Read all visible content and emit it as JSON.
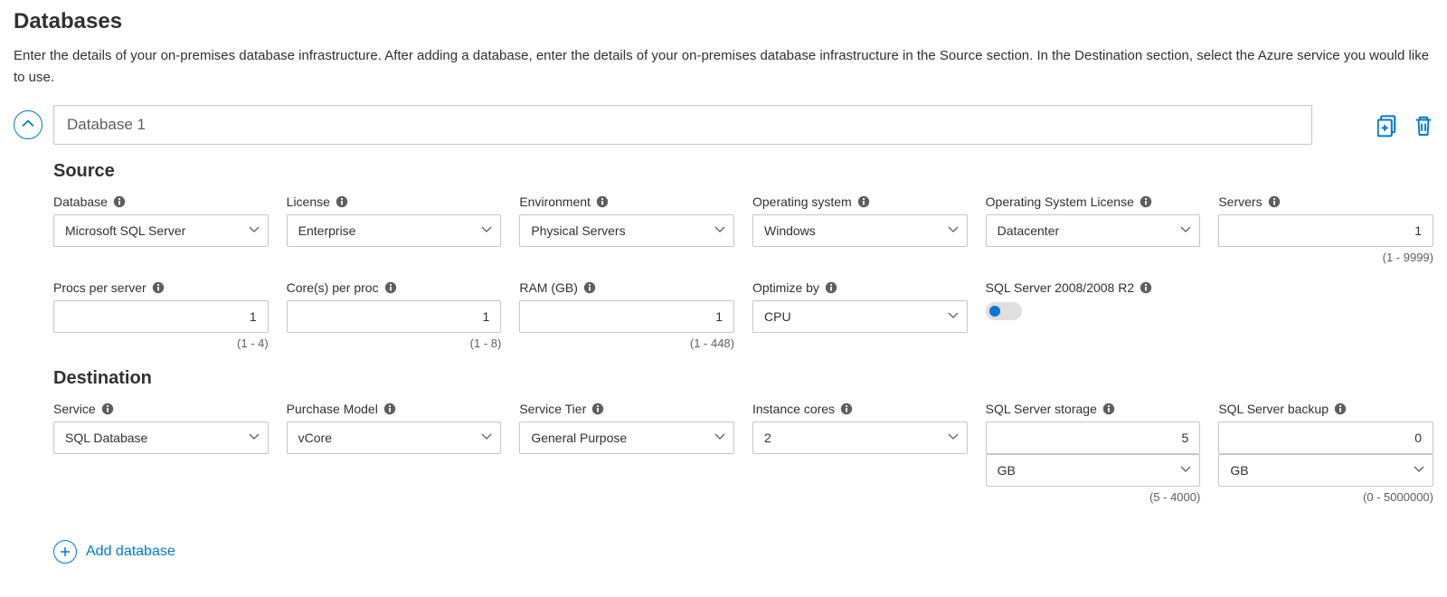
{
  "page": {
    "title": "Databases",
    "description": "Enter the details of your on-premises database infrastructure. After adding a database, enter the details of your on-premises database infrastructure in the Source section. In the Destination section, select the Azure service you would like to use."
  },
  "item": {
    "name": "Database 1"
  },
  "source": {
    "title": "Source",
    "database": {
      "label": "Database",
      "value": "Microsoft SQL Server"
    },
    "license": {
      "label": "License",
      "value": "Enterprise"
    },
    "environment": {
      "label": "Environment",
      "value": "Physical Servers"
    },
    "os": {
      "label": "Operating system",
      "value": "Windows"
    },
    "os_license": {
      "label": "Operating System License",
      "value": "Datacenter"
    },
    "servers": {
      "label": "Servers",
      "value": "1",
      "hint": "(1 - 9999)"
    },
    "procs": {
      "label": "Procs per server",
      "value": "1",
      "hint": "(1 - 4)"
    },
    "cores": {
      "label": "Core(s) per proc",
      "value": "1",
      "hint": "(1 - 8)"
    },
    "ram": {
      "label": "RAM (GB)",
      "value": "1",
      "hint": "(1 - 448)"
    },
    "optimize": {
      "label": "Optimize by",
      "value": "CPU"
    },
    "sql2008": {
      "label": "SQL Server 2008/2008 R2",
      "value": false
    }
  },
  "dest": {
    "title": "Destination",
    "service": {
      "label": "Service",
      "value": "SQL Database"
    },
    "purchase": {
      "label": "Purchase Model",
      "value": "vCore"
    },
    "tier": {
      "label": "Service Tier",
      "value": "General Purpose"
    },
    "cores": {
      "label": "Instance cores",
      "value": "2"
    },
    "storage": {
      "label": "SQL Server storage",
      "value": "5",
      "unit": "GB",
      "hint": "(5 - 4000)"
    },
    "backup": {
      "label": "SQL Server backup",
      "value": "0",
      "unit": "GB",
      "hint": "(0 - 5000000)"
    }
  },
  "actions": {
    "add": "Add database"
  }
}
